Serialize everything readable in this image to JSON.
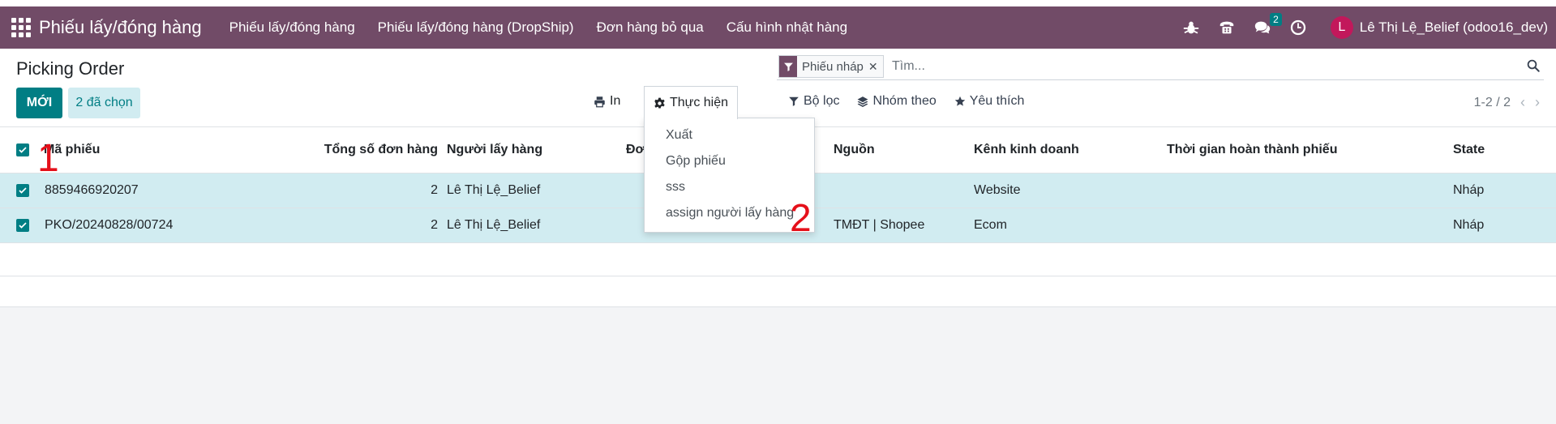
{
  "navbar": {
    "brand": "Phiếu lấy/đóng hàng",
    "menu": [
      "Phiếu lấy/đóng hàng",
      "Phiếu lấy/đóng hàng (DropShip)",
      "Đơn hàng bỏ qua",
      "Cấu hình nhật hàng"
    ],
    "message_count": "2",
    "user_initial": "L",
    "user_name": "Lê Thị Lệ_Belief (odoo16_dev)",
    "icons": [
      "bug-icon",
      "phone-icon",
      "chat-icon",
      "clock-icon"
    ]
  },
  "control": {
    "title": "Picking Order",
    "new_label": "MỚI",
    "selected_label": "2 đã chọn",
    "print_label": "In",
    "action_label": "Thực hiện"
  },
  "search": {
    "facet": "Phiếu nháp",
    "placeholder": "Tìm..."
  },
  "filters": {
    "filter_label": "Bộ lọc",
    "group_label": "Nhóm theo",
    "favorite_label": "Yêu thích"
  },
  "pager": {
    "value": "1-2 / 2"
  },
  "table": {
    "columns": [
      "Mã phiếu",
      "Tổng số đơn hàng",
      "Người lấy hàng",
      "Đơn",
      "Nguồn",
      "Kênh kinh doanh",
      "Thời gian hoàn thành phiếu",
      "State"
    ],
    "rows": [
      {
        "code": "8859466920207",
        "total": "2",
        "picker": "Lê Thị Lệ_Belief",
        "source": "",
        "channel": "Website",
        "done_time": "",
        "state": "Nháp"
      },
      {
        "code": "PKO/20240828/00724",
        "total": "2",
        "picker": "Lê Thị Lệ_Belief",
        "source": "TMĐT | Shopee",
        "channel": "Ecom",
        "done_time": "",
        "state": "Nháp"
      }
    ]
  },
  "dropdown": {
    "items": [
      "Xuất",
      "Gộp phiếu",
      "sss",
      "assign người lấy hàng"
    ]
  },
  "annotations": {
    "one": "1",
    "two": "2"
  },
  "colors": {
    "brand": "#714b67",
    "primary": "#017e84",
    "selected_row": "#d1ecf1",
    "annotation": "#e5101a"
  }
}
